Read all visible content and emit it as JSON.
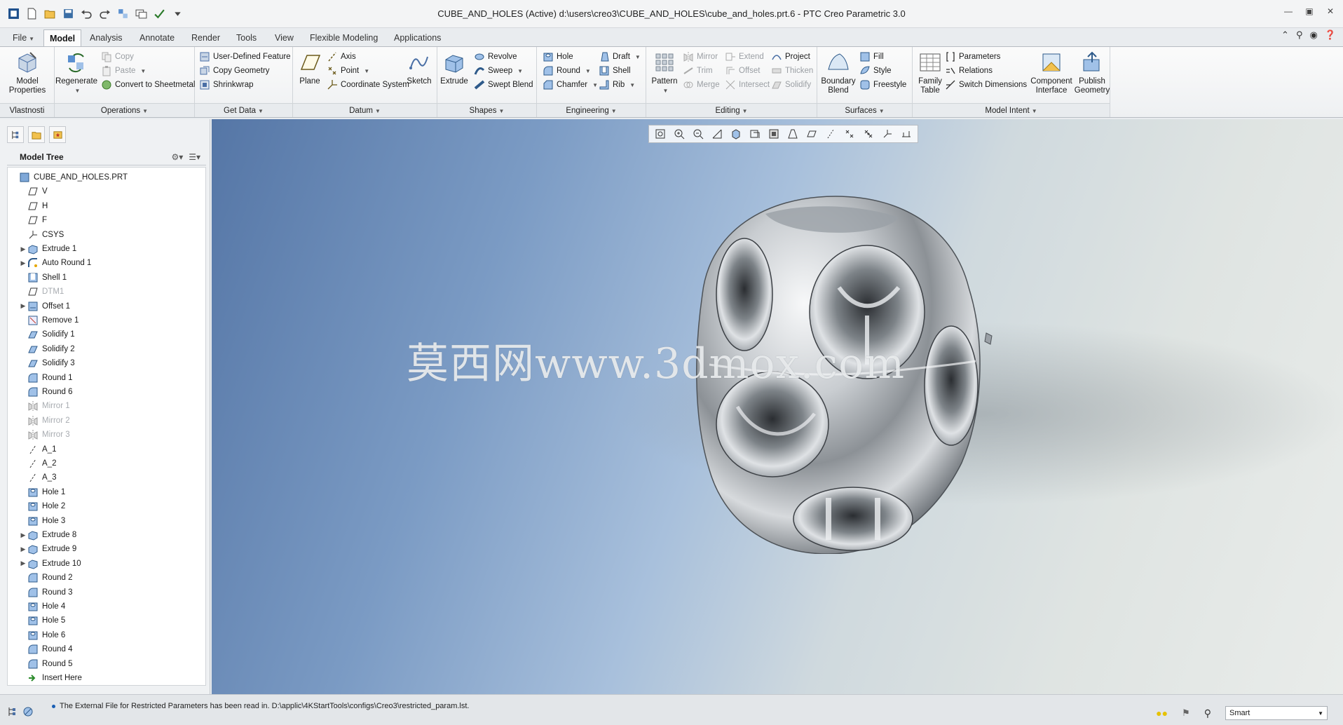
{
  "window": {
    "title": "CUBE_AND_HOLES (Active) d:\\users\\creo3\\CUBE_AND_HOLES\\cube_and_holes.prt.6 - PTC Creo Parametric 3.0"
  },
  "quick_access": [
    "app-icon",
    "new-icon",
    "open-icon",
    "save-icon",
    "undo-icon",
    "redo-icon",
    "regenerate-icon",
    "windows-icon",
    "close-icon",
    "customize-icon"
  ],
  "tabs": [
    {
      "label": "File",
      "has_dropdown": true
    },
    {
      "label": "Model",
      "active": true
    },
    {
      "label": "Analysis"
    },
    {
      "label": "Annotate"
    },
    {
      "label": "Render"
    },
    {
      "label": "Tools"
    },
    {
      "label": "View"
    },
    {
      "label": "Flexible Modeling"
    },
    {
      "label": "Applications"
    }
  ],
  "ribbon": {
    "groups": [
      {
        "label": "Vlastnosti"
      },
      {
        "label": "Operations"
      },
      {
        "label": "Get Data"
      },
      {
        "label": "Datum"
      },
      {
        "label": "Shapes"
      },
      {
        "label": "Engineering"
      },
      {
        "label": "Editing"
      },
      {
        "label": "Surfaces"
      },
      {
        "label": "Model Intent"
      }
    ],
    "model_properties": "Model Properties",
    "regenerate": "Regenerate",
    "copy": "Copy",
    "paste": "Paste",
    "convert_to_sheetmetal": "Convert to Sheetmetal",
    "user_defined_feature": "User-Defined Feature",
    "copy_geometry": "Copy Geometry",
    "shrinkwrap": "Shrinkwrap",
    "plane": "Plane",
    "axis": "Axis",
    "point": "Point",
    "coordinate_system": "Coordinate System",
    "sketch": "Sketch",
    "extrude": "Extrude",
    "revolve": "Revolve",
    "sweep": "Sweep",
    "swept_blend": "Swept Blend",
    "hole": "Hole",
    "round": "Round",
    "chamfer": "Chamfer",
    "draft": "Draft",
    "shell": "Shell",
    "rib": "Rib",
    "pattern": "Pattern",
    "mirror": "Mirror",
    "trim": "Trim",
    "merge": "Merge",
    "extend": "Extend",
    "offset": "Offset",
    "intersect": "Intersect",
    "project": "Project",
    "thicken": "Thicken",
    "solidify": "Solidify",
    "boundary_blend": "Boundary Blend",
    "fill": "Fill",
    "style": "Style",
    "freestyle": "Freestyle",
    "family_table": "Family Table",
    "parameters": "Parameters",
    "relations": "Relations",
    "switch_dimensions": "Switch Dimensions",
    "component_interface": "Component Interface",
    "publish_geometry": "Publish Geometry"
  },
  "model_tree": {
    "header": "Model Tree",
    "items": [
      {
        "label": "CUBE_AND_HOLES.PRT",
        "icon": "part-icon",
        "level": 0
      },
      {
        "label": "V",
        "icon": "datum-plane-icon",
        "level": 1
      },
      {
        "label": "H",
        "icon": "datum-plane-icon",
        "level": 1
      },
      {
        "label": "F",
        "icon": "datum-plane-icon",
        "level": 1
      },
      {
        "label": "CSYS",
        "icon": "csys-icon",
        "level": 1
      },
      {
        "label": "Extrude 1",
        "icon": "extrude-icon",
        "level": 1,
        "expandable": true
      },
      {
        "label": "Auto Round 1",
        "icon": "auto-round-icon",
        "level": 1,
        "expandable": true
      },
      {
        "label": "Shell 1",
        "icon": "shell-icon",
        "level": 1
      },
      {
        "label": "DTM1",
        "icon": "datum-plane-icon",
        "level": 1,
        "disabled": true
      },
      {
        "label": "Offset 1",
        "icon": "offset-icon",
        "level": 1,
        "expandable": true
      },
      {
        "label": "Remove 1",
        "icon": "remove-icon",
        "level": 1
      },
      {
        "label": "Solidify 1",
        "icon": "solidify-icon",
        "level": 1
      },
      {
        "label": "Solidify 2",
        "icon": "solidify-icon",
        "level": 1
      },
      {
        "label": "Solidify 3",
        "icon": "solidify-icon",
        "level": 1
      },
      {
        "label": "Round 1",
        "icon": "round-icon",
        "level": 1
      },
      {
        "label": "Round 6",
        "icon": "round-icon",
        "level": 1
      },
      {
        "label": "Mirror 1",
        "icon": "mirror-icon",
        "level": 1,
        "disabled": true
      },
      {
        "label": "Mirror 2",
        "icon": "mirror-icon",
        "level": 1,
        "disabled": true
      },
      {
        "label": "Mirror 3",
        "icon": "mirror-icon",
        "level": 1,
        "disabled": true
      },
      {
        "label": "A_1",
        "icon": "axis-icon",
        "level": 1
      },
      {
        "label": "A_2",
        "icon": "axis-icon",
        "level": 1
      },
      {
        "label": "A_3",
        "icon": "axis-icon",
        "level": 1
      },
      {
        "label": "Hole 1",
        "icon": "hole-icon",
        "level": 1
      },
      {
        "label": "Hole 2",
        "icon": "hole-icon",
        "level": 1
      },
      {
        "label": "Hole 3",
        "icon": "hole-icon",
        "level": 1
      },
      {
        "label": "Extrude 8",
        "icon": "extrude-icon",
        "level": 1,
        "expandable": true
      },
      {
        "label": "Extrude 9",
        "icon": "extrude-icon",
        "level": 1,
        "expandable": true
      },
      {
        "label": "Extrude 10",
        "icon": "extrude-icon",
        "level": 1,
        "expandable": true
      },
      {
        "label": "Round 2",
        "icon": "round-icon",
        "level": 1
      },
      {
        "label": "Round 3",
        "icon": "round-icon",
        "level": 1
      },
      {
        "label": "Hole 4",
        "icon": "hole-icon",
        "level": 1
      },
      {
        "label": "Hole 5",
        "icon": "hole-icon",
        "level": 1
      },
      {
        "label": "Hole 6",
        "icon": "hole-icon",
        "level": 1
      },
      {
        "label": "Round 4",
        "icon": "round-icon",
        "level": 1
      },
      {
        "label": "Round 5",
        "icon": "round-icon",
        "level": 1
      },
      {
        "label": "Insert Here",
        "icon": "insert-here-icon",
        "level": 1
      }
    ]
  },
  "viewport": {
    "watermark": "莫西网www.3dmox.com",
    "toolbar": [
      "refit-icon",
      "zoom-in-icon",
      "zoom-out-icon",
      "repaint-icon",
      "display-style-icon",
      "saved-orientations-icon",
      "view-manager-icon",
      "perspective-icon",
      "datum-display-icon",
      "plane-display-icon",
      "axis-display-icon",
      "point-display-icon",
      "csys-display-icon",
      "annotation-display-icon"
    ]
  },
  "status": {
    "message": "The External File for Restricted Parameters has been read in. D:\\applic\\4KStartTools\\configs\\Creo3\\restricted_param.lst.",
    "filter_value": "Smart"
  }
}
